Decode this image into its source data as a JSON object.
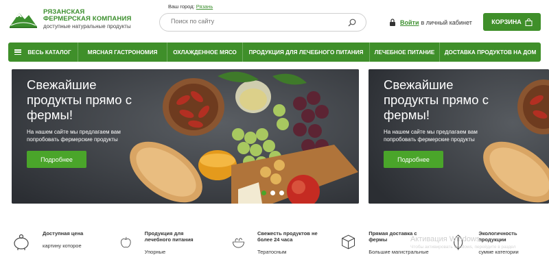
{
  "header": {
    "logo": {
      "line1": "РЯЗАНСКАЯ",
      "line2": "ФЕРМЕРСКАЯ КОМПАНИЯ",
      "tagline": "доступные натуральные продукты"
    },
    "city_label": "Ваш город:",
    "city_value": "Рязань",
    "search": {
      "placeholder": "Поиск по сайту"
    },
    "login_link": "Войти",
    "login_suffix": "в личный кабинет",
    "cart_label": "КОРЗИНА"
  },
  "nav": {
    "items": [
      {
        "label": "ВЕСЬ КАТАЛОГ"
      },
      {
        "label": "МЯСНАЯ ГАСТРОНОМИЯ"
      },
      {
        "label": "ОХЛАЖДЕННОЕ МЯСО"
      },
      {
        "label": "ПРОДУКЦИЯ ДЛЯ ЛЕЧЕБНОГО ПИТАНИЯ"
      },
      {
        "label": "ЛЕЧЕБНОЕ ПИТАНИЕ"
      },
      {
        "label": "ДОСТАВКА ПРОДУКТОВ НА ДОМ"
      }
    ]
  },
  "banners": [
    {
      "title": "Свежайшие продукты прямо с фермы!",
      "text": "На нашем сайте мы предлагаем вам попробовать фермерские продукты",
      "button": "Подробнее"
    },
    {
      "title": "Свежайшие продукты прямо с фермы!",
      "text": "На нашем сайте мы предлагаем вам попробовать фермерские продукты",
      "button": "Подробнее"
    }
  ],
  "features": [
    {
      "title": "Доступная цена",
      "text": "картину которое",
      "icon": "piggy-bank-icon"
    },
    {
      "title": "Продукция для лечебного питания",
      "text": "Упорные",
      "icon": "apple-icon"
    },
    {
      "title": "Свежесть продуктов не более 24 часа",
      "text": "Тератосным",
      "icon": "salad-bowl-icon"
    },
    {
      "title": "Прямая доставка с фермы",
      "text": "Большие магистральные",
      "icon": "box-icon"
    },
    {
      "title": "Экологичность продукции",
      "text": "сумме категории",
      "icon": "leaf-icon"
    }
  ],
  "os_watermark": {
    "title": "Активация Windows",
    "text": "Чтобы активировать Windows, перейдите в раздел"
  },
  "colors": {
    "brand_green": "#3f8f2a",
    "button_green": "#4aa52a",
    "logo_green": "#3c8f2e"
  }
}
